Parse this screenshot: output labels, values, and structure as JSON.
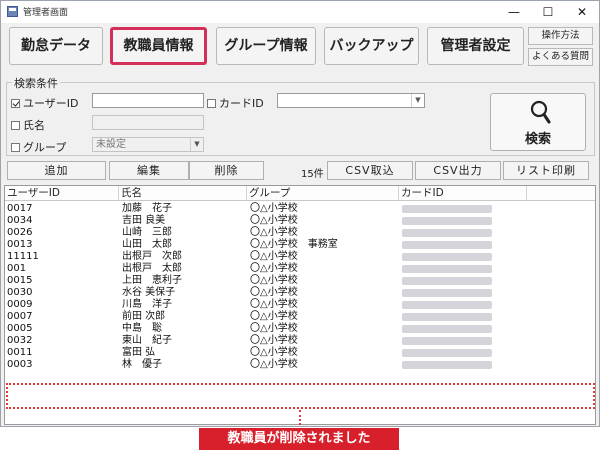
{
  "window": {
    "title": "管理者画面",
    "controls": {
      "minimize": "—",
      "maximize": "☐",
      "close": "✕"
    }
  },
  "menu": {
    "kintai": "勤怠データ",
    "staff": "教職員情報",
    "group": "グループ情報",
    "backup": "バックアップ",
    "admin": "管理者設定",
    "howto": "操作方法",
    "faq": "よくある質問"
  },
  "search": {
    "legend": "検索条件",
    "user_id_label": "ユーザーID",
    "card_id_label": "カードID",
    "name_label": "氏名",
    "group_label": "グループ",
    "group_value": "未設定",
    "button_label": "検索"
  },
  "actions": {
    "add": "追加",
    "edit": "編集",
    "delete": "削除",
    "count": "15件",
    "import": "CSV取込",
    "export": "CSV出力",
    "print": "リスト印刷"
  },
  "table": {
    "columns": [
      "ユーザーID",
      "氏名",
      "グループ",
      "カードID"
    ],
    "rows": [
      {
        "id": "0017",
        "name": "加藤　花子",
        "group": "〇△小学校"
      },
      {
        "id": "0034",
        "name": "吉田 良美",
        "group": "〇△小学校"
      },
      {
        "id": "0026",
        "name": "山崎　三郎",
        "group": "〇△小学校"
      },
      {
        "id": "0013",
        "name": "山田　太郎",
        "group": "〇△小学校　事務室"
      },
      {
        "id": "11111",
        "name": "出根戸　次郎",
        "group": "〇△小学校"
      },
      {
        "id": "001",
        "name": "出根戸　太郎",
        "group": "〇△小学校"
      },
      {
        "id": "0015",
        "name": "上田　恵利子",
        "group": "〇△小学校"
      },
      {
        "id": "0030",
        "name": "水谷 美保子",
        "group": "〇△小学校"
      },
      {
        "id": "0009",
        "name": "川島　洋子",
        "group": "〇△小学校"
      },
      {
        "id": "0007",
        "name": "前田 次郎",
        "group": "〇△小学校"
      },
      {
        "id": "0005",
        "name": "中島　聡",
        "group": "〇△小学校"
      },
      {
        "id": "0032",
        "name": "東山　紀子",
        "group": "〇△小学校"
      },
      {
        "id": "0011",
        "name": "富田 弘",
        "group": "〇△小学校"
      },
      {
        "id": "0003",
        "name": "林　優子",
        "group": "〇△小学校"
      }
    ]
  },
  "callout": "教職員が削除されました",
  "colors": {
    "highlight": "#d32f5a",
    "callout_bg": "#d81f2c"
  }
}
